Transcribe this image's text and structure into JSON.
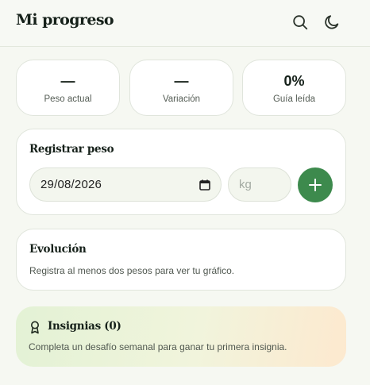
{
  "header": {
    "title": "Mi progreso",
    "icons": [
      "search-icon",
      "moon-icon"
    ]
  },
  "stats": [
    {
      "value": "—",
      "label": "Peso actual"
    },
    {
      "value": "—",
      "label": "Variación"
    },
    {
      "value": "0%",
      "label": "Guía leída"
    }
  ],
  "register": {
    "title": "Registrar peso",
    "date_value": "29/08/2026",
    "weight_placeholder": "kg",
    "add_icon": "plus-icon"
  },
  "evolution": {
    "title": "Evolución",
    "description": "Registra al menos dos pesos para ver tu gráfico."
  },
  "badges": {
    "title": "Insignias (0)",
    "description": "Completa un desafío semanal para ganar tu primera insignia.",
    "icon": "award-icon"
  },
  "colors": {
    "accent": "#3d8a4d",
    "background": "#f6f8f2",
    "badge_gradient_start": "#e3f2d5",
    "badge_gradient_end": "#fde9cf"
  }
}
